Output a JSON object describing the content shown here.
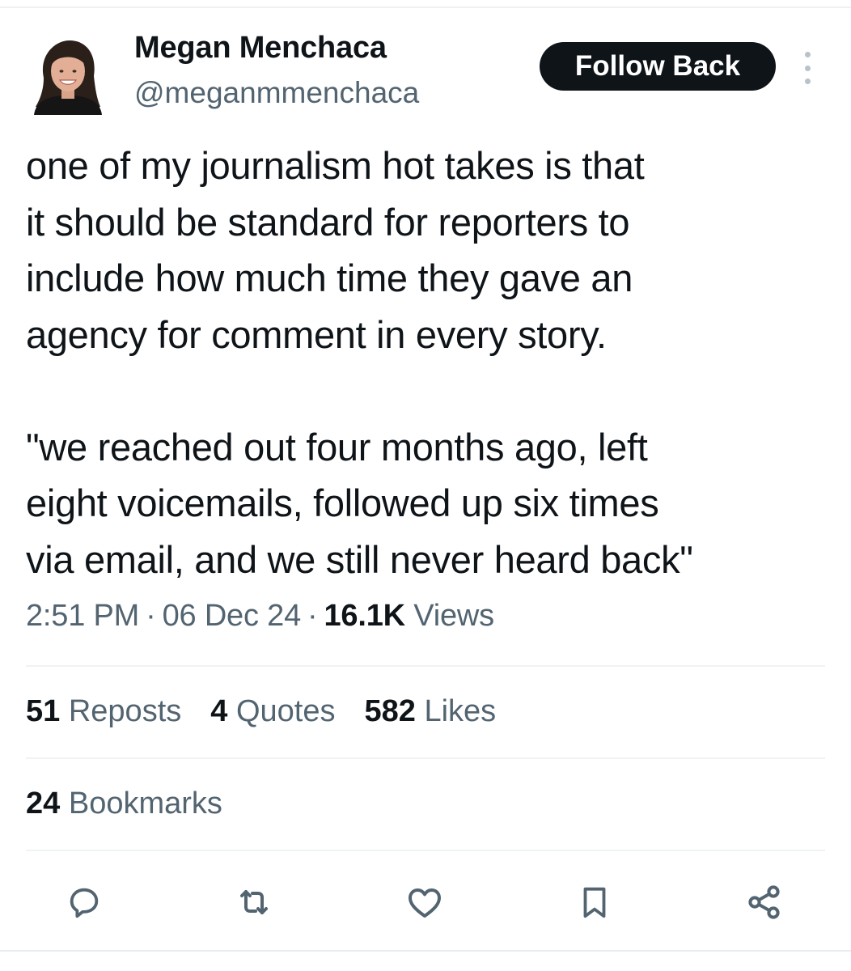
{
  "author": {
    "display_name": "Megan Menchaca",
    "handle": "@meganmmenchaca",
    "avatar_icon": "profile-photo"
  },
  "header": {
    "follow_label": "Follow Back",
    "more_icon": "more-vertical-icon"
  },
  "tweet": {
    "paragraphs": [
      [
        "one of my journalism hot takes is that",
        "it should be standard for reporters to",
        "include how much time they gave an",
        "agency for comment in every story."
      ],
      [
        "\"we reached out four months ago, left",
        "eight voicemails, followed up six times",
        "via email, and we still never heard back\""
      ]
    ]
  },
  "meta": {
    "time": "2:51 PM",
    "separator": "·",
    "date": "06 Dec 24",
    "views_count": "16.1K",
    "views_label": "Views"
  },
  "stats": {
    "reposts_count": "51",
    "reposts_label": "Reposts",
    "quotes_count": "4",
    "quotes_label": "Quotes",
    "likes_count": "582",
    "likes_label": "Likes",
    "bookmarks_count": "24",
    "bookmarks_label": "Bookmarks"
  },
  "actions": [
    "reply-icon",
    "repost-icon",
    "like-icon",
    "bookmark-icon",
    "share-icon"
  ],
  "colors": {
    "text_primary": "#0f1419",
    "text_secondary": "#536471",
    "button_bg": "#0f1419",
    "button_text": "#ffffff",
    "divider": "#eff3f4"
  }
}
